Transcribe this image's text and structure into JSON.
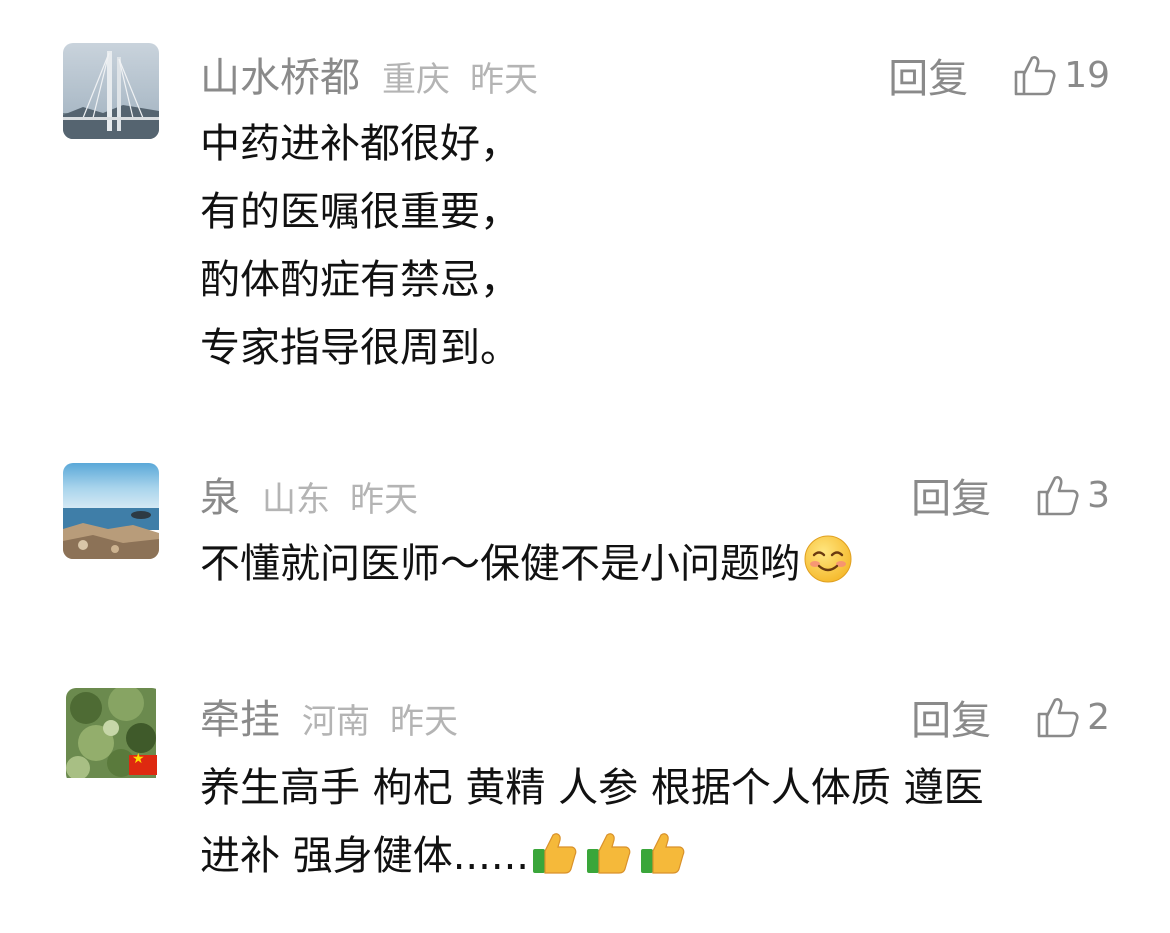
{
  "comments": [
    {
      "username": "山水桥都",
      "location": "重庆",
      "time": "昨天",
      "reply_label": "回复",
      "likes": "19",
      "lines": [
        "中药进补都很好，",
        "有的医嘱很重要，",
        "酌体酌症有禁忌，",
        "专家指导很周到。"
      ]
    },
    {
      "username": "泉",
      "location": "山东",
      "time": "昨天",
      "reply_label": "回复",
      "likes": "3",
      "lines": [
        "不懂就问医师～保健不是小问题哟"
      ],
      "emoji": "smiling-face-emoji"
    },
    {
      "username": "牵挂",
      "location": "河南",
      "time": "昨天",
      "reply_label": "回复",
      "likes": "2",
      "lines": [
        "养生高手 枸杞 黄精 人参 根据个人体质 遵医",
        "进补 强身健体......"
      ],
      "emoji": "thumbs-up-emoji"
    }
  ],
  "colors": {
    "username": "#8a8a8a",
    "meta": "#b4b4b4",
    "text": "#111111"
  }
}
